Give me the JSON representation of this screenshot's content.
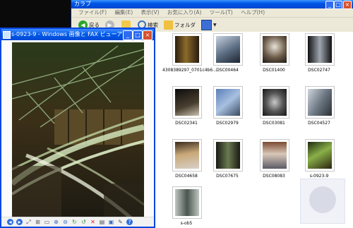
{
  "explorer": {
    "title": "カラブ",
    "menu": [
      "ファイル(F)",
      "編集(E)",
      "表示(V)",
      "お気に入り(A)",
      "ツール(T)",
      "ヘルプ(H)"
    ],
    "toolbar": {
      "back": "戻る",
      "search": "検索",
      "folder": "フォルダ"
    },
    "files": [
      "4308389297_0701c4b6...",
      "DSC00464",
      "DSC01400",
      "DSC02747",
      "DSC02341",
      "DSC02979",
      "DSC03081",
      "DSC04527",
      "DSC04658",
      "DSC07675",
      "DSC08083",
      "s-0923-9",
      "s-ob5"
    ]
  },
  "viewer": {
    "title": "s-0923-9 - Windows 画像と FAX ビューア"
  },
  "colors": {
    "title_blue": "#0055e5",
    "close_red": "#d9502d"
  }
}
